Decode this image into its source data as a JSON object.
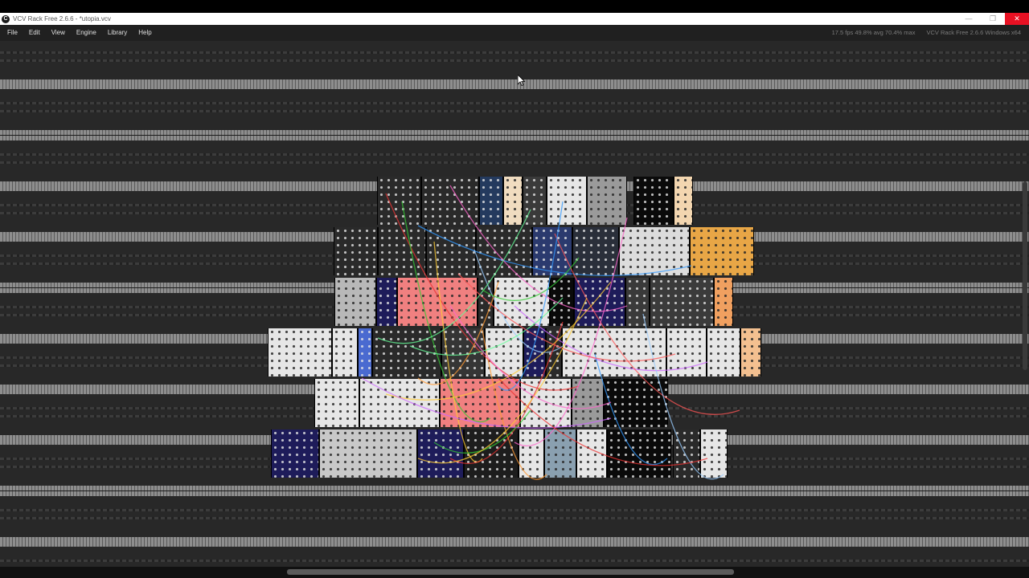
{
  "window": {
    "title": "VCV Rack Free 2.6.6 - *utopia.vcv",
    "controls": {
      "minimize": "—",
      "restore": "❐",
      "close": "✕"
    }
  },
  "menu": [
    "File",
    "Edit",
    "View",
    "Engine",
    "Library",
    "Help"
  ],
  "status": {
    "fps": "17.5 fps",
    "avg": "49.8% avg",
    "max": "70.4% max",
    "version": "VCV Rack Free 2.6.6 Windows x64"
  },
  "colors": {
    "rail_background": "#282828",
    "rail_metal": "#8e8e8e",
    "module_panel_light": "#e6e6e6",
    "module_panel_pink": "#f08080",
    "module_panel_navy": "#1e1c5a",
    "module_panel_orange": "#e8a646"
  }
}
